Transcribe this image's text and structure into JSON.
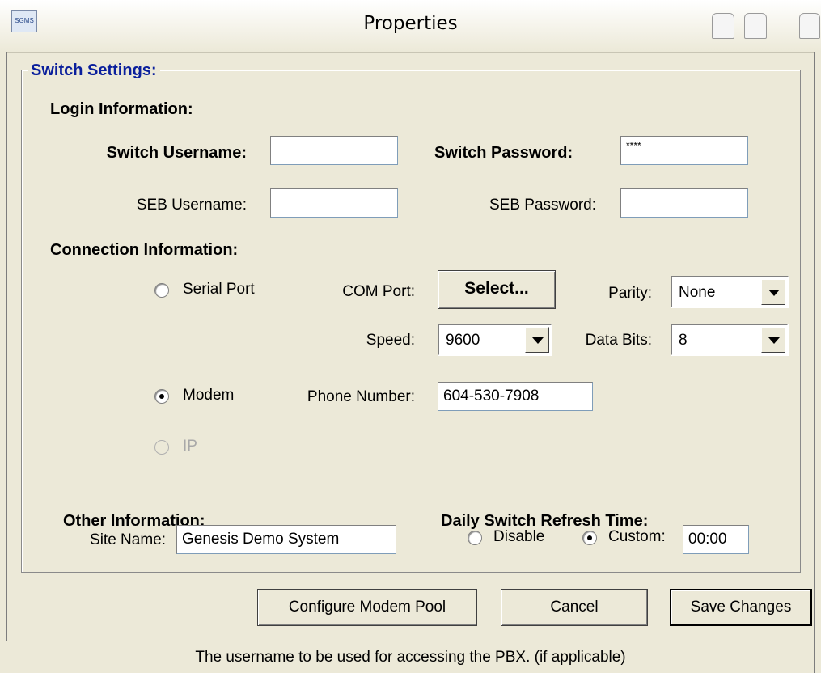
{
  "window": {
    "title": "Properties",
    "icon": "app-icon"
  },
  "group": {
    "legend": "Switch Settings:"
  },
  "login": {
    "heading": "Login Information:",
    "switch_username_label": "Switch Username:",
    "switch_username_value": "",
    "switch_password_label": "Switch Password:",
    "switch_password_value": "****",
    "seb_username_label": "SEB Username:",
    "seb_username_value": "",
    "seb_password_label": "SEB Password:",
    "seb_password_value": ""
  },
  "connection": {
    "heading": "Connection Information:",
    "serial_port_label": "Serial Port",
    "serial_port_checked": false,
    "com_port_label": "COM Port:",
    "select_button": "Select...",
    "parity_label": "Parity:",
    "parity_value": "None",
    "speed_label": "Speed:",
    "speed_value": "9600",
    "data_bits_label": "Data Bits:",
    "data_bits_value": "8",
    "modem_label": "Modem",
    "modem_checked": true,
    "phone_label": "Phone Number:",
    "phone_value": "604-530-7908",
    "ip_label": "IP",
    "ip_enabled": false
  },
  "other": {
    "heading": "Other Information:",
    "site_name_label": "Site Name:",
    "site_name_value": "Genesis Demo System"
  },
  "refresh": {
    "heading": "Daily Switch Refresh Time:",
    "disable_label": "Disable",
    "disable_checked": false,
    "custom_label": "Custom:",
    "custom_checked": true,
    "custom_time": "00:00"
  },
  "buttons": {
    "configure_modem_pool": "Configure Modem Pool",
    "cancel": "Cancel",
    "save_changes": "Save Changes"
  },
  "status": {
    "text": "The username to be used for accessing the PBX. (if applicable)"
  }
}
